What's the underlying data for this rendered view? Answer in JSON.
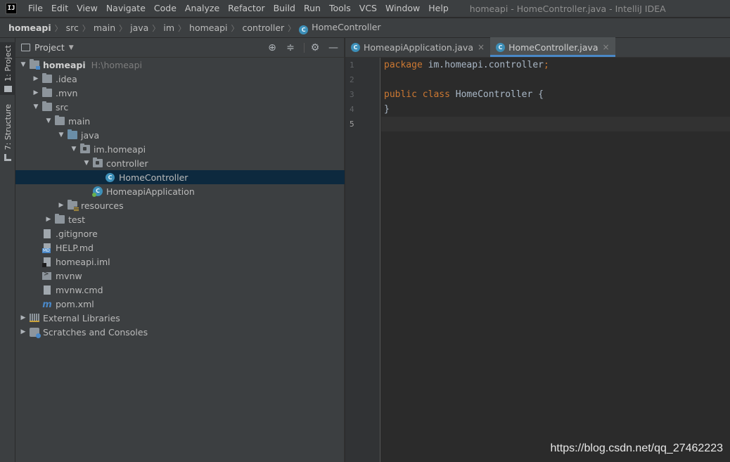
{
  "app": {
    "logo_text": "IJ",
    "window_title": "homeapi - HomeController.java - IntelliJ IDEA"
  },
  "menu": [
    "File",
    "Edit",
    "View",
    "Navigate",
    "Code",
    "Analyze",
    "Refactor",
    "Build",
    "Run",
    "Tools",
    "VCS",
    "Window",
    "Help"
  ],
  "breadcrumb": [
    "homeapi",
    "src",
    "main",
    "java",
    "im",
    "homeapi",
    "controller",
    "HomeController"
  ],
  "left_stripe": {
    "project_label": "1: Project",
    "structure_label": "7: Structure"
  },
  "project_panel": {
    "title": "Project",
    "tools": [
      "locate-icon",
      "collapse-icon",
      "gear-icon",
      "minimize-icon"
    ],
    "tree": [
      {
        "label": "homeapi",
        "extra": "H:\\homeapi",
        "level": 0,
        "expanded": true,
        "icon": "module-folder-icon"
      },
      {
        "label": ".idea",
        "level": 1,
        "expanded": false,
        "icon": "folder-icon"
      },
      {
        "label": ".mvn",
        "level": 1,
        "expanded": false,
        "icon": "folder-icon"
      },
      {
        "label": "src",
        "level": 1,
        "expanded": true,
        "icon": "folder-icon"
      },
      {
        "label": "main",
        "level": 2,
        "expanded": true,
        "icon": "folder-icon"
      },
      {
        "label": "java",
        "level": 3,
        "expanded": true,
        "icon": "source-folder-icon"
      },
      {
        "label": "im.homeapi",
        "level": 4,
        "expanded": true,
        "icon": "package-icon"
      },
      {
        "label": "controller",
        "level": 5,
        "expanded": true,
        "icon": "package-icon"
      },
      {
        "label": "HomeController",
        "level": 6,
        "leaf": true,
        "icon": "class-icon",
        "selected": true
      },
      {
        "label": "HomeapiApplication",
        "level": 5,
        "leaf": true,
        "icon": "spring-app-icon"
      },
      {
        "label": "resources",
        "level": 3,
        "expanded": false,
        "icon": "resources-folder-icon"
      },
      {
        "label": "test",
        "level": 2,
        "expanded": false,
        "icon": "folder-icon"
      },
      {
        "label": ".gitignore",
        "level": 1,
        "leaf": true,
        "icon": "file-icon"
      },
      {
        "label": "HELP.md",
        "level": 1,
        "leaf": true,
        "icon": "markdown-icon"
      },
      {
        "label": "homeapi.iml",
        "level": 1,
        "leaf": true,
        "icon": "iml-icon"
      },
      {
        "label": "mvnw",
        "level": 1,
        "leaf": true,
        "icon": "script-icon"
      },
      {
        "label": "mvnw.cmd",
        "level": 1,
        "leaf": true,
        "icon": "file-icon"
      },
      {
        "label": "pom.xml",
        "level": 1,
        "leaf": true,
        "icon": "maven-icon"
      },
      {
        "label": "External Libraries",
        "level": 0,
        "expanded": false,
        "icon": "libraries-icon"
      },
      {
        "label": "Scratches and Consoles",
        "level": 0,
        "expanded": false,
        "icon": "scratches-icon"
      }
    ]
  },
  "editor": {
    "tabs": [
      {
        "label": "HomeapiApplication.java",
        "active": false
      },
      {
        "label": "HomeController.java",
        "active": true
      }
    ],
    "line_numbers": [
      "1",
      "2",
      "3",
      "4",
      "5"
    ],
    "current_line": 5,
    "code": [
      [
        {
          "t": "package",
          "c": "kw"
        },
        {
          "t": " im.homeapi.controller",
          "c": "cls"
        },
        {
          "t": ";",
          "c": "semi"
        }
      ],
      [],
      [
        {
          "t": "public",
          "c": "kw"
        },
        {
          "t": " ",
          "c": "cls"
        },
        {
          "t": "class",
          "c": "kw"
        },
        {
          "t": " HomeController {",
          "c": "cls"
        }
      ],
      [
        {
          "t": "}",
          "c": "cls"
        }
      ],
      []
    ]
  },
  "watermark": "https://blog.csdn.net/qq_27462223",
  "colors": {
    "keyword": "#cc7832",
    "selection": "#0d293e",
    "accent": "#4a88c7"
  }
}
